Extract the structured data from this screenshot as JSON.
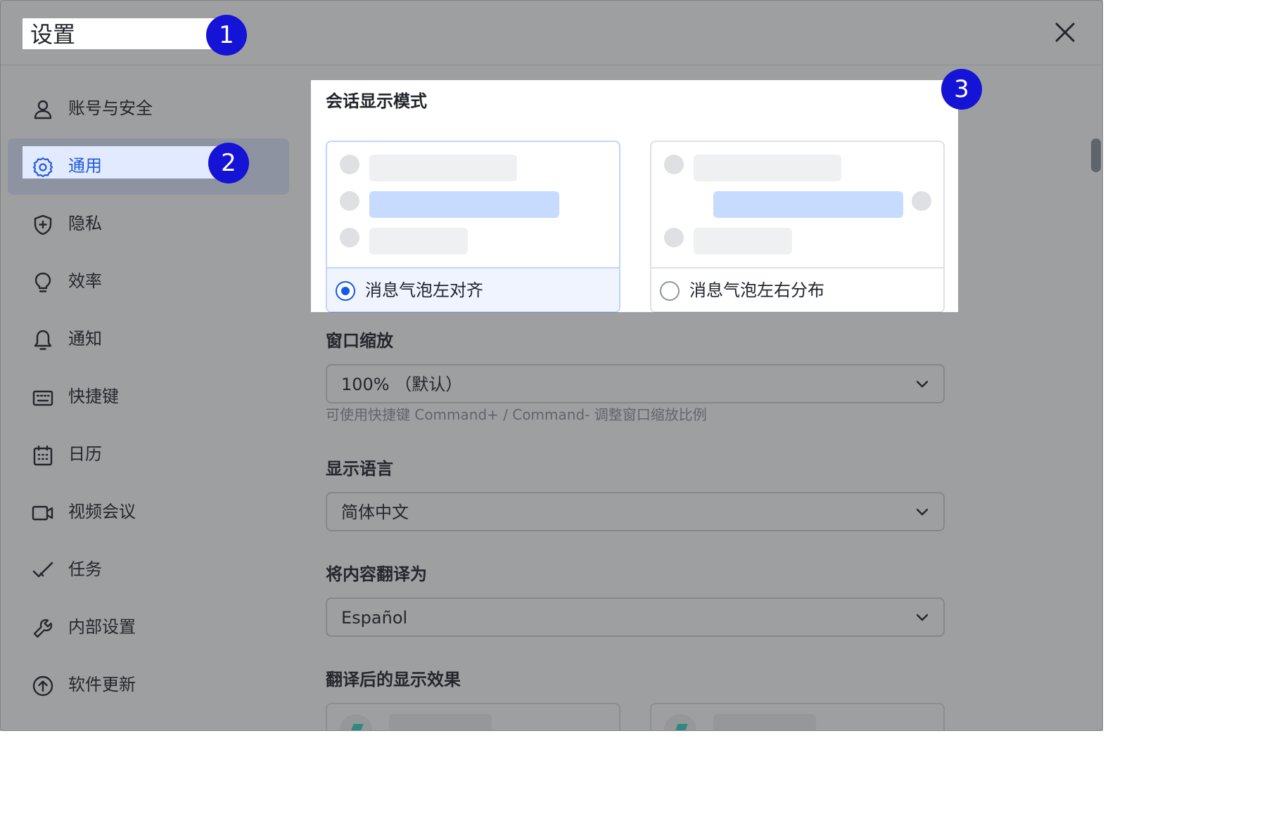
{
  "header": {
    "title": "设置",
    "close_icon": "close-icon"
  },
  "sidebar": {
    "items": [
      {
        "label": "账号与安全",
        "icon": "user-icon"
      },
      {
        "label": "通用",
        "icon": "gear-icon",
        "active": true
      },
      {
        "label": "隐私",
        "icon": "shield-icon"
      },
      {
        "label": "效率",
        "icon": "lightbulb-icon"
      },
      {
        "label": "通知",
        "icon": "bell-icon"
      },
      {
        "label": "快捷键",
        "icon": "keyboard-icon"
      },
      {
        "label": "日历",
        "icon": "calendar-icon"
      },
      {
        "label": "视频会议",
        "icon": "video-icon"
      },
      {
        "label": "任务",
        "icon": "check-icon"
      },
      {
        "label": "内部设置",
        "icon": "wrench-icon"
      },
      {
        "label": "软件更新",
        "icon": "upgrade-icon"
      }
    ]
  },
  "content": {
    "chat_mode": {
      "title": "会话显示模式",
      "options": [
        {
          "label": "消息气泡左对齐",
          "selected": true
        },
        {
          "label": "消息气泡左右分布",
          "selected": false
        }
      ]
    },
    "zoom": {
      "title": "窗口缩放",
      "value": "100% （默认）",
      "hint": "可使用快捷键 Command+ / Command- 调整窗口缩放比例"
    },
    "language": {
      "title": "显示语言",
      "value": "简体中文"
    },
    "translate_to": {
      "title": "将内容翻译为",
      "value": "Español"
    },
    "translation_display": {
      "title": "翻译后的显示效果"
    }
  },
  "annotations": [
    "1",
    "2",
    "3"
  ],
  "colors": {
    "accent": "#1456f0",
    "badge": "#1413d6",
    "active_bg": "#e1eaff",
    "bubble_blue": "#c7daff",
    "overlay": "rgba(40,42,46,0.45)"
  }
}
